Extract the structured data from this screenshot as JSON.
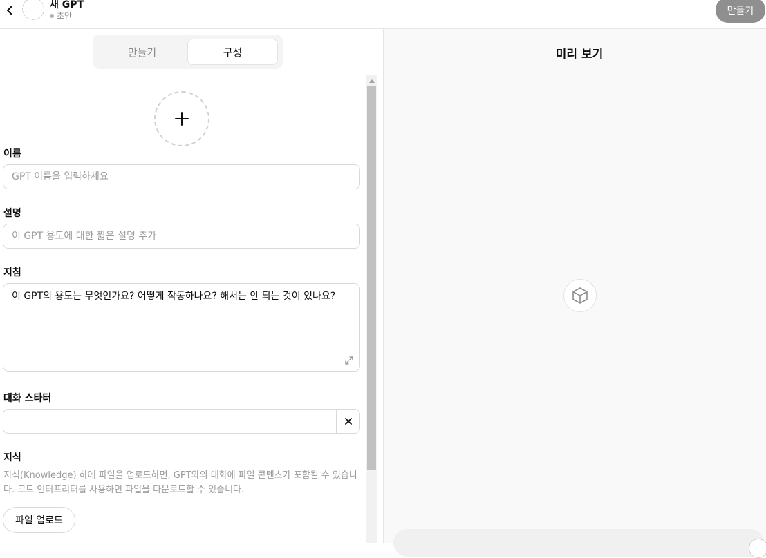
{
  "header": {
    "title": "새 GPT",
    "status": "초안",
    "create_label": "만들기"
  },
  "tabs": [
    {
      "label": "만들기",
      "active": false
    },
    {
      "label": "구성",
      "active": true
    }
  ],
  "form": {
    "name_label": "이름",
    "name_placeholder": "GPT 이름을 입력하세요",
    "description_label": "설명",
    "description_placeholder": "이 GPT 용도에 대한 짧은 설명 추가",
    "instructions_label": "지침",
    "instructions_text": "이 GPT의 용도는 무엇인가요? 어떻게 작동하나요? 해서는 안 되는 것이 있나요?",
    "starters_label": "대화 스타터",
    "knowledge_label": "지식",
    "knowledge_desc": "지식(Knowledge) 하에 파일을 업로드하면, GPT와의 대화에 파일 콘텐츠가 포함될 수 있습니다. 코드 인터프리터를 사용하면 파일을 다운로드할 수 있습니다.",
    "upload_label": "파일 업로드"
  },
  "preview": {
    "title": "미리 보기"
  },
  "icons": {
    "back": "chevron-left-icon",
    "plus": "plus-icon",
    "expand": "expand-icon",
    "close": "close-icon",
    "cube": "cube-icon"
  }
}
